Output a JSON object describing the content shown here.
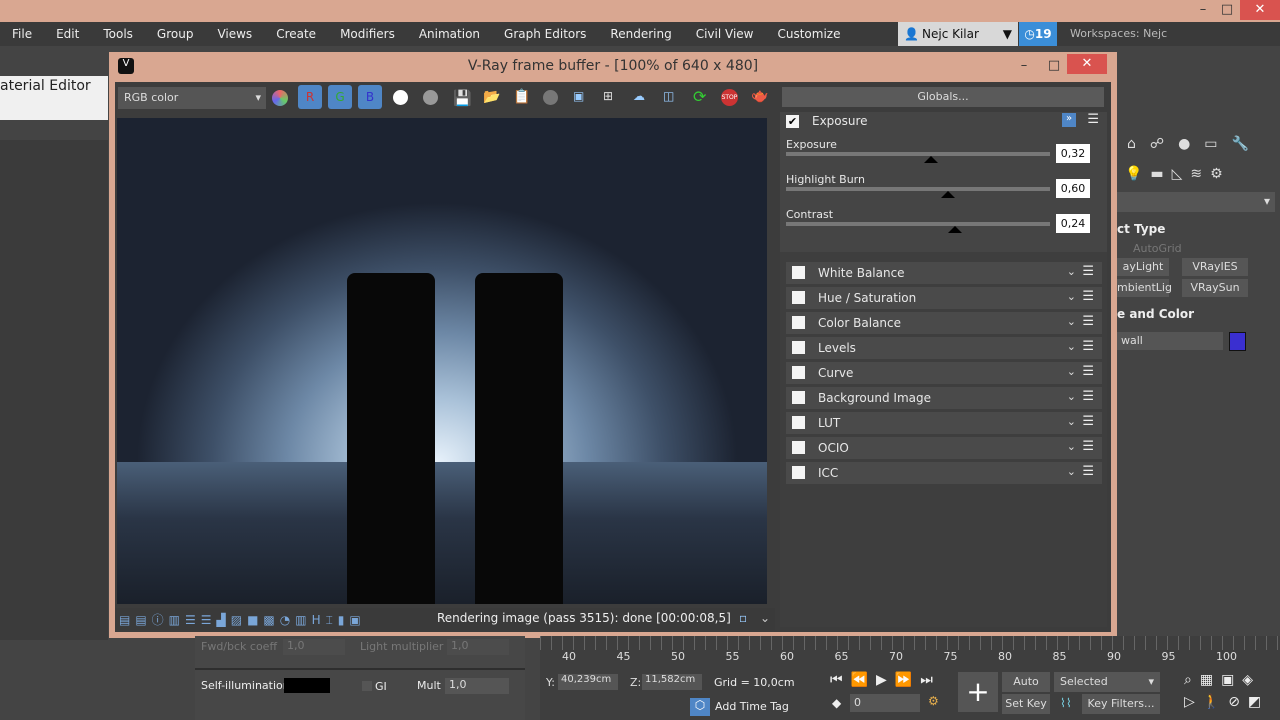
{
  "menu": [
    "File",
    "Edit",
    "Tools",
    "Group",
    "Views",
    "Create",
    "Modifiers",
    "Animation",
    "Graph Editors",
    "Rendering",
    "Civil View",
    "Customize"
  ],
  "user": {
    "name": "Nejc Kilar",
    "notifications": "19",
    "workspaces_label": "Workspaces:",
    "workspace": "Nejc"
  },
  "material_editor_title": "aterial Editor",
  "vfb": {
    "title": "V-Ray frame buffer - [100% of 640 x 480]",
    "channel": "RGB color",
    "channels": [
      "R",
      "G",
      "B"
    ],
    "globals": "Globals...",
    "status": "Rendering image (pass 3515): done [00:00:08,5]",
    "exposure": {
      "label": "Exposure",
      "enabled": true,
      "sliders": [
        {
          "label": "Exposure",
          "value": "0,32",
          "fraction": 0.53
        },
        {
          "label": "Highlight Burn",
          "value": "0,60",
          "fraction": 0.6
        },
        {
          "label": "Contrast",
          "value": "0,24",
          "fraction": 0.63
        }
      ]
    },
    "layers": [
      "White Balance",
      "Hue / Saturation",
      "Color Balance",
      "Levels",
      "Curve",
      "Background Image",
      "LUT",
      "OCIO",
      "ICC"
    ]
  },
  "command_panel": {
    "section1": "ct Type",
    "autogrid": "AutoGrid",
    "buttons": [
      "ayLight",
      "VRayIES",
      "mbientLig",
      "VRaySun"
    ],
    "section2": "e and Color",
    "name": "wall",
    "color": "#3a2fd0"
  },
  "material_params": {
    "fwd_label": "Fwd/bck coeff",
    "fwd_value": "1,0",
    "light_mult_label": "Light multiplier",
    "light_mult_value": "1,0",
    "self_illum_label": "Self-illumination",
    "gi_label": "GI",
    "mult_label": "Mult",
    "mult_value": "1,0"
  },
  "timeline": {
    "ticks": [
      "40",
      "45",
      "50",
      "55",
      "60",
      "65",
      "70",
      "75",
      "80",
      "85",
      "90",
      "95",
      "100"
    ],
    "y_label": "Y:",
    "y": "40,239cm",
    "z_label": "Z:",
    "z": "11,582cm",
    "grid": "Grid = 10,0cm",
    "add_time_tag": "Add Time Tag",
    "frame": "0",
    "auto_key": "Auto Key",
    "set_key": "Set Key",
    "selected": "Selected",
    "key_filters": "Key Filters..."
  }
}
